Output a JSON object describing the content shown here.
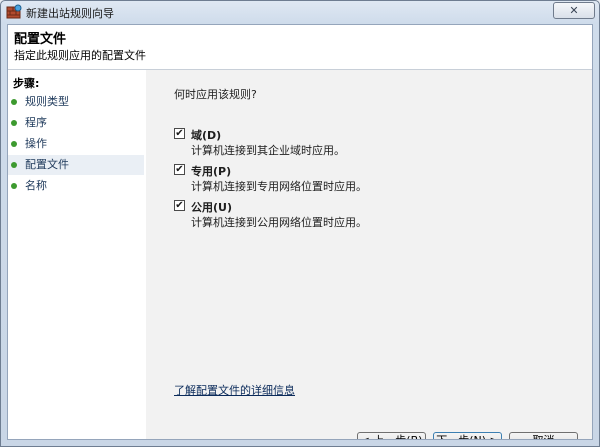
{
  "window": {
    "title": "新建出站规则向导",
    "close_glyph": "✕"
  },
  "header": {
    "title": "配置文件",
    "subtitle": "指定此规则应用的配置文件"
  },
  "sidebar": {
    "steps_title": "步骤:",
    "items": [
      {
        "label": "规则类型",
        "active": false
      },
      {
        "label": "程序",
        "active": false
      },
      {
        "label": "操作",
        "active": false
      },
      {
        "label": "配置文件",
        "active": true
      },
      {
        "label": "名称",
        "active": false
      }
    ]
  },
  "main": {
    "question": "何时应用该规则?",
    "options": [
      {
        "label": "域(D)",
        "description": "计算机连接到其企业域时应用。",
        "checked": true
      },
      {
        "label": "专用(P)",
        "description": "计算机连接到专用网络位置时应用。",
        "checked": true
      },
      {
        "label": "公用(U)",
        "description": "计算机连接到公用网络位置时应用。",
        "checked": true
      }
    ],
    "learn_more_link": "了解配置文件的详细信息"
  },
  "buttons": {
    "back": "< 上一步(B)",
    "next": "下一步(N) >",
    "cancel": "取消"
  },
  "icons": {
    "step_dot": "green-bullet-icon",
    "app": "firewall-icon",
    "check": "checkmark-icon"
  },
  "colors": {
    "step_dot": "#3d9a2f",
    "content_bg": "#f2f2f2"
  }
}
